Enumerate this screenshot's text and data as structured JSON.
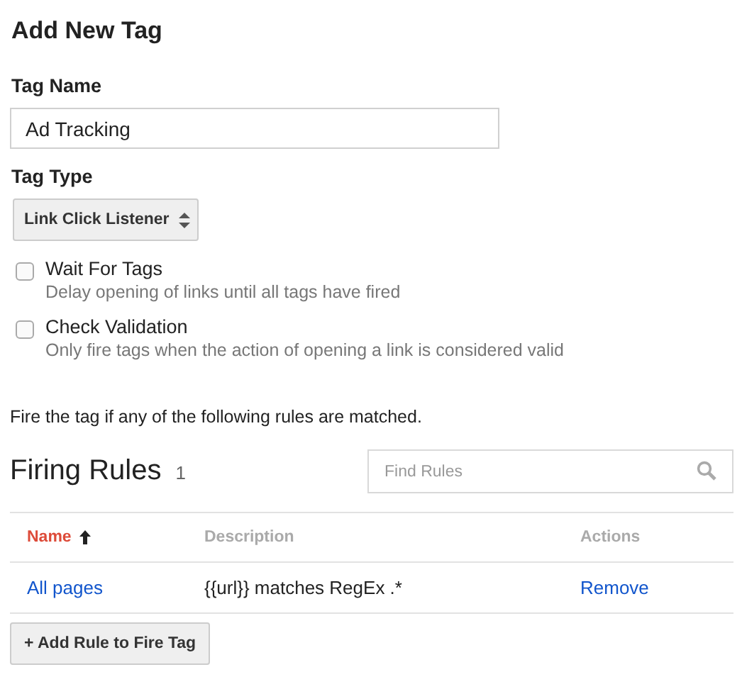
{
  "title": "Add New Tag",
  "tag_name": {
    "label": "Tag Name",
    "value": "Ad Tracking"
  },
  "tag_type": {
    "label": "Tag Type",
    "value": "Link Click Listener"
  },
  "options": [
    {
      "label": "Wait For Tags",
      "description": "Delay opening of links until all tags have fired",
      "checked": false
    },
    {
      "label": "Check Validation",
      "description": "Only fire tags when the action of opening a link is considered valid",
      "checked": false
    }
  ],
  "rules_intro": "Fire the tag if any of the following rules are matched.",
  "firing_rules": {
    "heading": "Firing Rules",
    "count": "1",
    "search": {
      "placeholder": "Find Rules"
    },
    "columns": [
      {
        "label": "Name",
        "sorted": true
      },
      {
        "label": "Description",
        "sorted": false
      },
      {
        "label": "Actions",
        "sorted": false
      }
    ],
    "rows": [
      {
        "name": "All pages",
        "description": "{{url}} matches RegEx .*",
        "action": "Remove"
      }
    ]
  },
  "add_button": "+ Add Rule to Fire Tag"
}
